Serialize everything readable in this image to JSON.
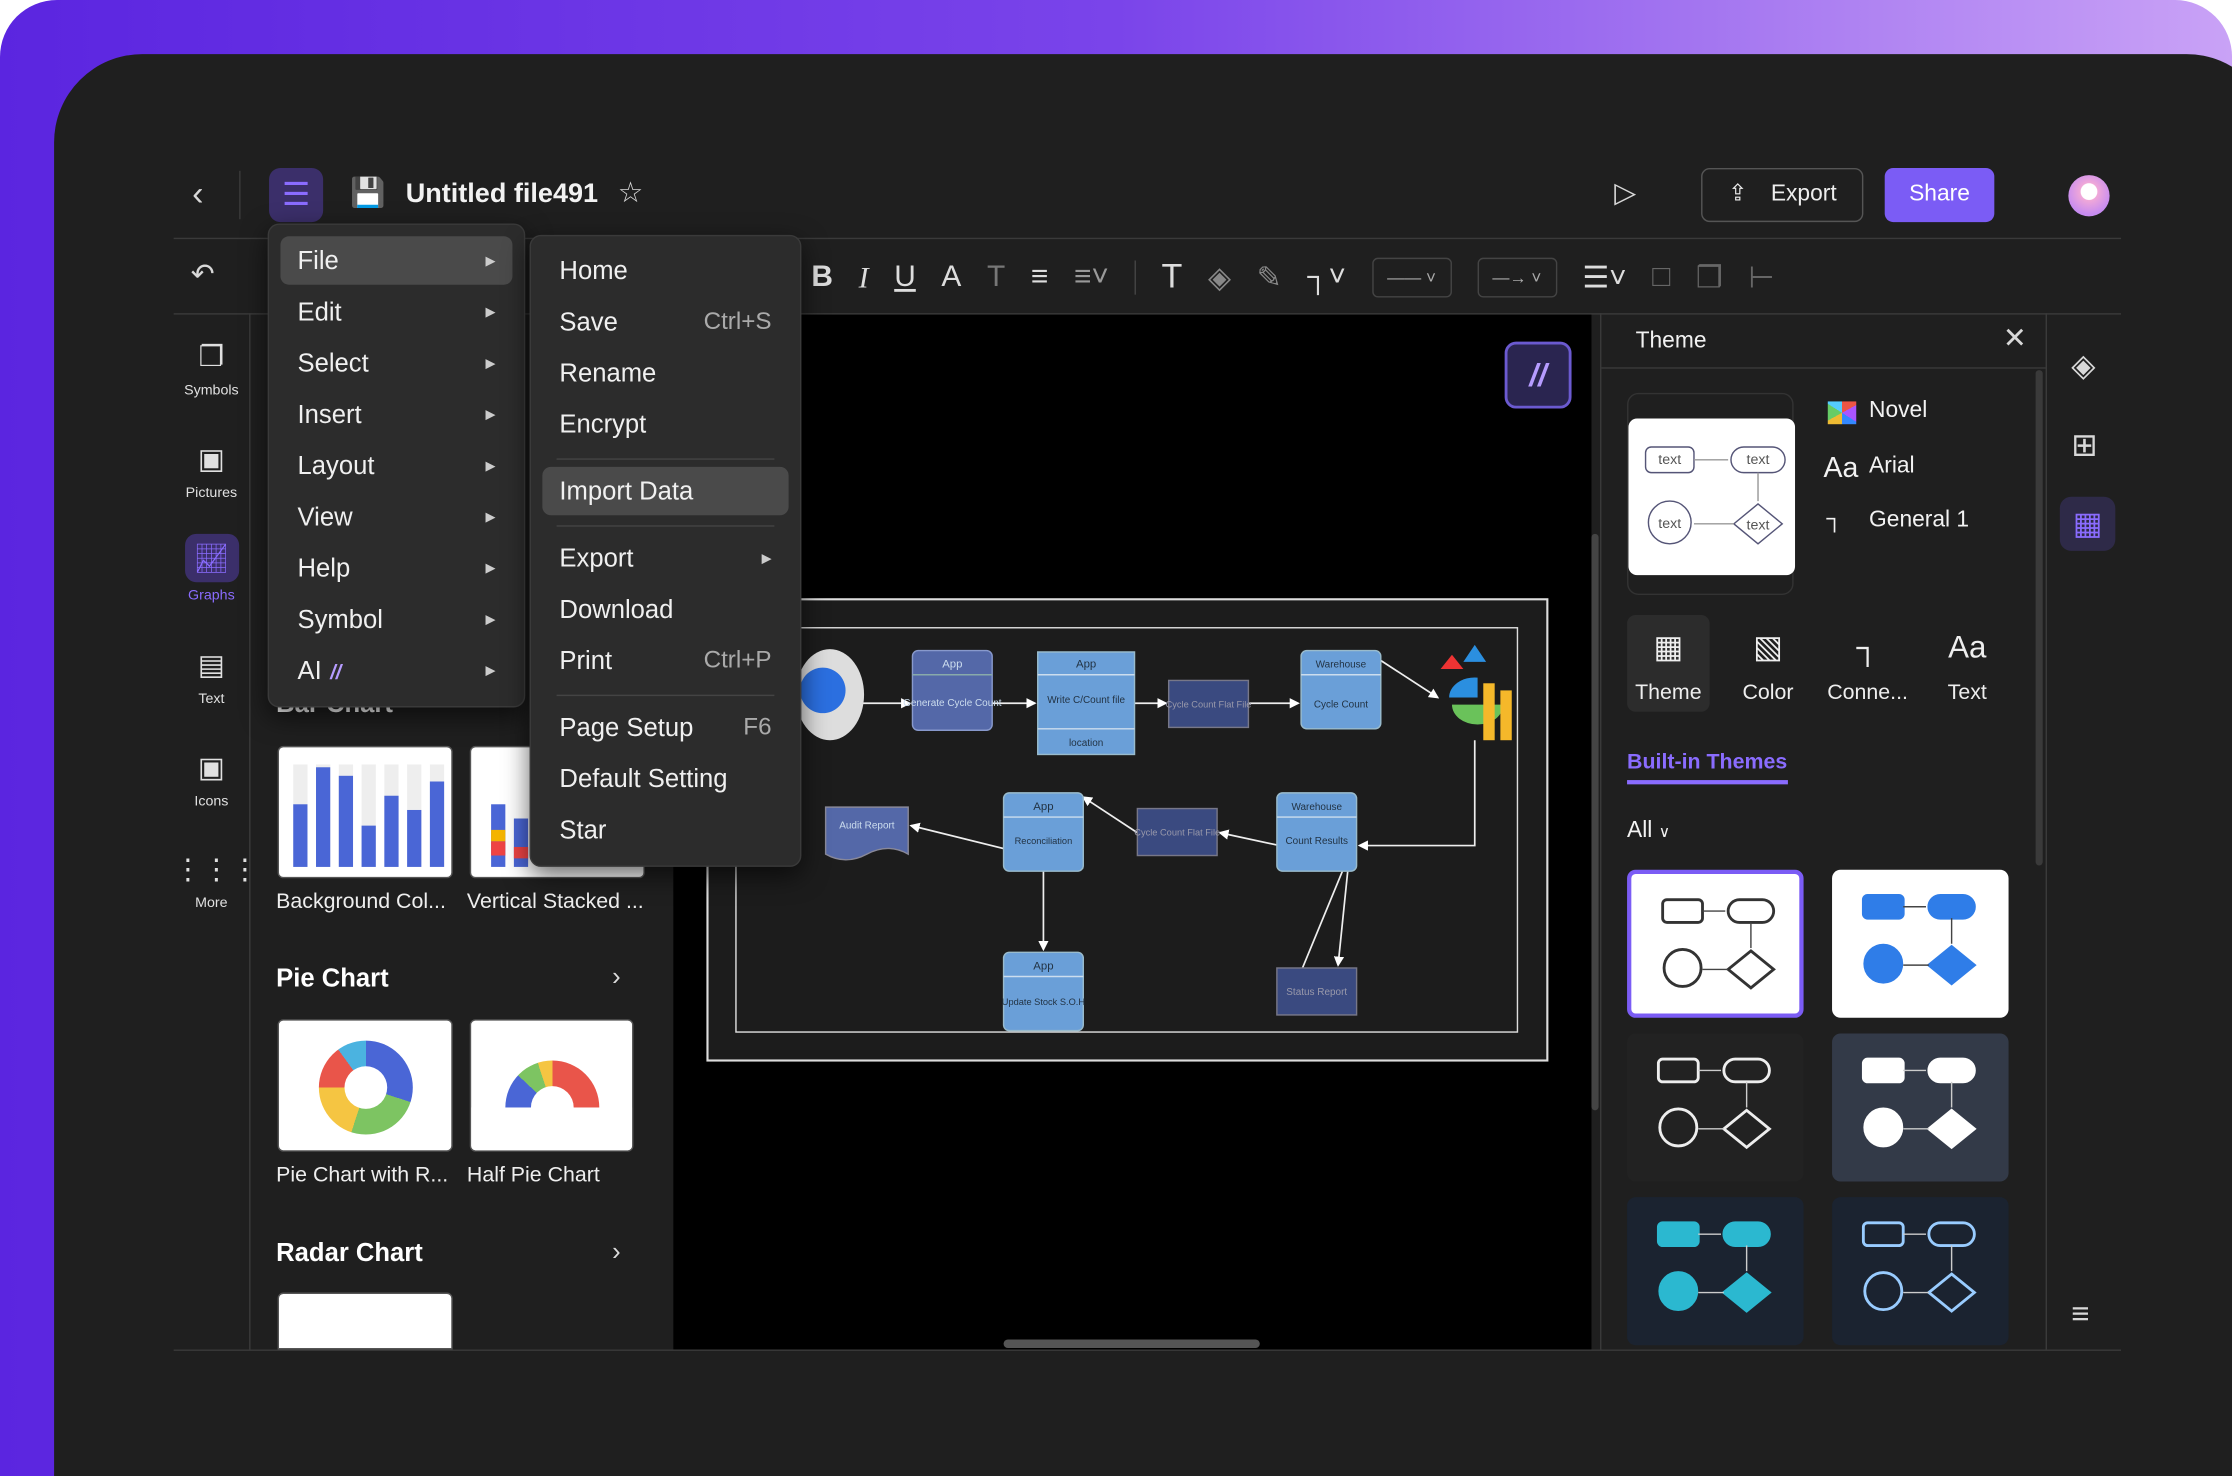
{
  "header": {
    "title": "Untitled file491",
    "export_label": "Export",
    "share_label": "Share"
  },
  "colors": {
    "accent": "#7b5cf5",
    "canvas": "#000000",
    "panel": "#1f1f1f",
    "node_light": "#6a9fd8",
    "node_dark": "#5468a8",
    "node_navy": "#3a4a80"
  },
  "toolbar": {
    "icons": [
      "undo-icon",
      "bold-icon",
      "italic-icon",
      "underline-icon",
      "font-color-icon",
      "strikethrough-icon",
      "align-icon",
      "line-spacing-icon",
      "text-icon",
      "fill-icon",
      "pen-icon",
      "connector-icon",
      "line-style-icon",
      "arrow-style-icon",
      "line-weight-icon",
      "group-icon",
      "shadow-icon",
      "arrange-icon"
    ]
  },
  "sidebar": {
    "items": [
      {
        "label": "Symbols",
        "icon": "symbols-icon"
      },
      {
        "label": "Pictures",
        "icon": "pictures-icon"
      },
      {
        "label": "Graphs",
        "icon": "graphs-icon",
        "active": true
      },
      {
        "label": "Text",
        "icon": "text-icon"
      },
      {
        "label": "Icons",
        "icon": "icons-icon"
      },
      {
        "label": "More",
        "icon": "more-icon"
      }
    ]
  },
  "library": {
    "bar_section": "Bar Chart",
    "bar_items": [
      "Background Col...",
      "Vertical Stacked ..."
    ],
    "pie_section": "Pie Chart",
    "pie_items": [
      "Pie Chart with R...",
      "Half Pie Chart"
    ],
    "radar_section": "Radar Chart"
  },
  "main_menu": {
    "items": [
      "File",
      "Edit",
      "Select",
      "Insert",
      "Layout",
      "View",
      "Help",
      "Symbol",
      "AI"
    ],
    "highlighted": "File"
  },
  "file_menu": {
    "items": [
      {
        "label": "Home"
      },
      {
        "label": "Save",
        "shortcut": "Ctrl+S"
      },
      {
        "label": "Rename"
      },
      {
        "label": "Encrypt"
      },
      {
        "label": "Import Data",
        "highlighted": true
      },
      {
        "label": "Export",
        "submenu": true
      },
      {
        "label": "Download"
      },
      {
        "label": "Print",
        "shortcut": "Ctrl+P"
      },
      {
        "label": "Page Setup",
        "shortcut": "F6"
      },
      {
        "label": "Default Setting"
      },
      {
        "label": "Star"
      }
    ]
  },
  "diagram": {
    "n1": {
      "head": "App",
      "body": "Generate Cycle Count"
    },
    "n2": {
      "head": "App",
      "body": "Write C/Count file",
      "foot": "location"
    },
    "n3": "Cycle Count Flat File",
    "n4": {
      "head": "Warehouse",
      "body": "Cycle Count"
    },
    "n5": "Audit Report",
    "n6": {
      "head": "App",
      "body": "Reconciliation"
    },
    "n7": "Cycle Count Flat File",
    "n8": {
      "head": "Warehouse",
      "body": "Count Results"
    },
    "n9": {
      "head": "App",
      "body": "Update Stock S.O.H"
    },
    "n10": "Status Report"
  },
  "theme_panel": {
    "title": "Theme",
    "preview_text": "text",
    "current": {
      "color": "Novel",
      "font": "Arial",
      "connector": "General 1"
    },
    "tabs": [
      "Theme",
      "Color",
      "Conne...",
      "Text"
    ],
    "active_tab": "Theme",
    "section": "Built-in Themes",
    "filter": "All"
  }
}
